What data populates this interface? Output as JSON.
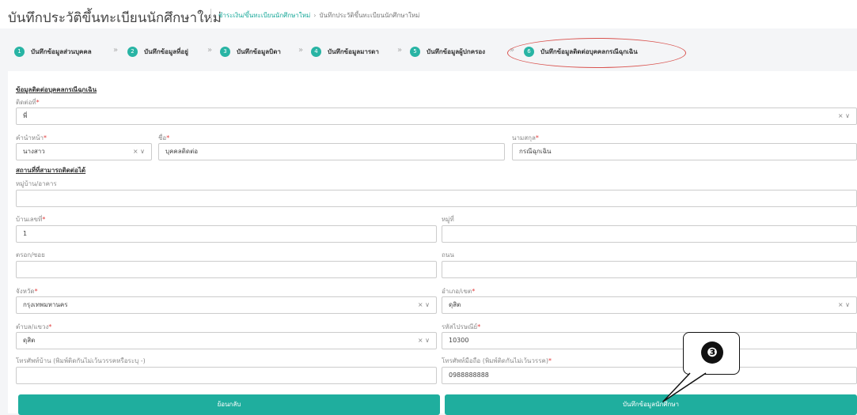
{
  "header": {
    "title": "บันทึกประวัติขึ้นทะเบียนนักศึกษาใหม่",
    "breadcrumb": [
      "ชำระเงิน/ขึ้นทะเบียนนักศึกษาใหม่",
      "บันทึกประวัติขึ้นทะเบียนนักศึกษาใหม่"
    ],
    "breadcrumb_sep": "›"
  },
  "steps": [
    {
      "num": "1",
      "label": "บันทึกข้อมูลส่วนบุคคล"
    },
    {
      "num": "2",
      "label": "บันทึกข้อมูลที่อยู่"
    },
    {
      "num": "3",
      "label": "บันทึกข้อมูลบิดา"
    },
    {
      "num": "4",
      "label": "บันทึกข้อมูลมารดา"
    },
    {
      "num": "5",
      "label": "บันทึกข้อมูลผู้ปกครอง"
    },
    {
      "num": "6",
      "label": "บันทึกข้อมูลติดต่อบุคคลกรณีฉุกเฉิน"
    }
  ],
  "step_chevron": "»",
  "form": {
    "section_title": "ข้อมูลติดต่อบุคคลกรณีฉุกเฉิน",
    "relationship": {
      "label": "ติดต่อที่",
      "value": "พี่"
    },
    "prefix": {
      "label": "คำนำหน้า",
      "value": "นางสาว"
    },
    "first_name": {
      "label": "ชื่อ",
      "value": "บุคคลติดต่อ"
    },
    "last_name": {
      "label": "นามสกุล",
      "value": "กรณีฉุกเฉิน"
    },
    "address_title": "สถานที่ที่สามารถติดต่อได้",
    "village": {
      "label": "หมู่บ้าน/อาคาร",
      "value": ""
    },
    "house_no": {
      "label": "บ้านเลขที่",
      "value": "1"
    },
    "moo": {
      "label": "หมู่ที่",
      "value": ""
    },
    "soi": {
      "label": "ตรอก/ซอย",
      "value": ""
    },
    "road": {
      "label": "ถนน",
      "value": ""
    },
    "province": {
      "label": "จังหวัด",
      "value": "กรุงเทพมหานคร"
    },
    "district": {
      "label": "อำเภอ/เขต",
      "value": "ดุสิต"
    },
    "subdistrict": {
      "label": "ตำบล/แขวง",
      "value": "ดุสิต"
    },
    "postcode": {
      "label": "รหัสไปรษณีย์",
      "value": "10300"
    },
    "home_phone": {
      "label": "โทรศัพท์บ้าน (พิมพ์ติดกันไม่เว้นวรรคหรือระบุ -)",
      "value": ""
    },
    "mobile_phone": {
      "label": "โทรศัพท์มือถือ (พิมพ์ติดกันไม่เว้นวรรค)",
      "value": "0988888888"
    },
    "required_mark": "*",
    "select_icons": "× ∨"
  },
  "buttons": {
    "back": "ย้อนกลับ",
    "save": "บันทึกข้อมูลนักศึกษา"
  },
  "callout": {
    "number": "❸"
  },
  "colors": {
    "accent": "#1fae9e",
    "highlight": "#d9534f"
  }
}
